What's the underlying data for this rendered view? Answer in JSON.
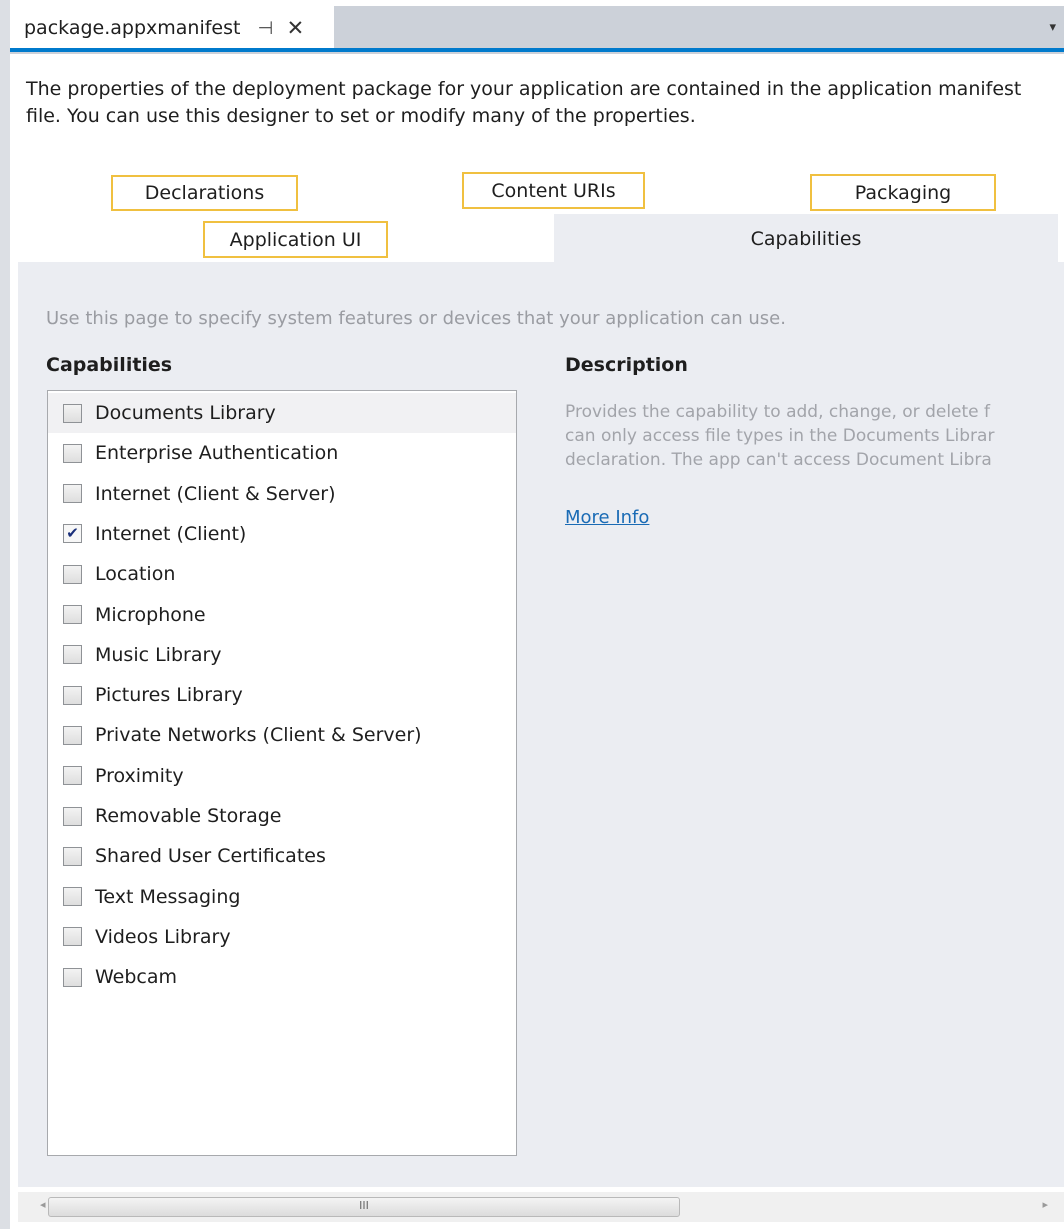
{
  "document_tab": {
    "title": "package.appxmanifest",
    "pin_glyph": "⊣",
    "close_glyph": "✕",
    "overflow_glyph": "▾"
  },
  "intro_text": "The properties of the deployment package for your application are contained in the application manifest file. You can use this designer to set or modify many of the properties.",
  "designer_tabs": {
    "declarations": "Declarations",
    "content_uris": "Content URIs",
    "packaging": "Packaging",
    "application_ui": "Application UI",
    "capabilities": "Capabilities"
  },
  "page_hint": "Use this page to specify system features or devices that your application can use.",
  "capabilities_heading": "Capabilities",
  "description_heading": "Description",
  "capabilities": [
    {
      "label": "Documents Library",
      "checked": false
    },
    {
      "label": "Enterprise Authentication",
      "checked": false
    },
    {
      "label": "Internet (Client & Server)",
      "checked": false
    },
    {
      "label": "Internet (Client)",
      "checked": true
    },
    {
      "label": "Location",
      "checked": false
    },
    {
      "label": "Microphone",
      "checked": false
    },
    {
      "label": "Music Library",
      "checked": false
    },
    {
      "label": "Pictures Library",
      "checked": false
    },
    {
      "label": "Private Networks (Client & Server)",
      "checked": false
    },
    {
      "label": "Proximity",
      "checked": false
    },
    {
      "label": "Removable Storage",
      "checked": false
    },
    {
      "label": "Shared User Certificates",
      "checked": false
    },
    {
      "label": "Text Messaging",
      "checked": false
    },
    {
      "label": "Videos Library",
      "checked": false
    },
    {
      "label": "Webcam",
      "checked": false
    }
  ],
  "description_lines": [
    "Provides the capability to add, change, or delete f",
    "can only access file types in the Documents Librar",
    "declaration. The app can't access Document Libra"
  ],
  "more_info": "More Info",
  "scrollbar": {
    "grip": "III",
    "left_arrow": "◂",
    "right_arrow": "▸"
  },
  "colors": {
    "accent": "#007acc",
    "highlight_border": "#f0c040",
    "link": "#1a6bb5"
  }
}
